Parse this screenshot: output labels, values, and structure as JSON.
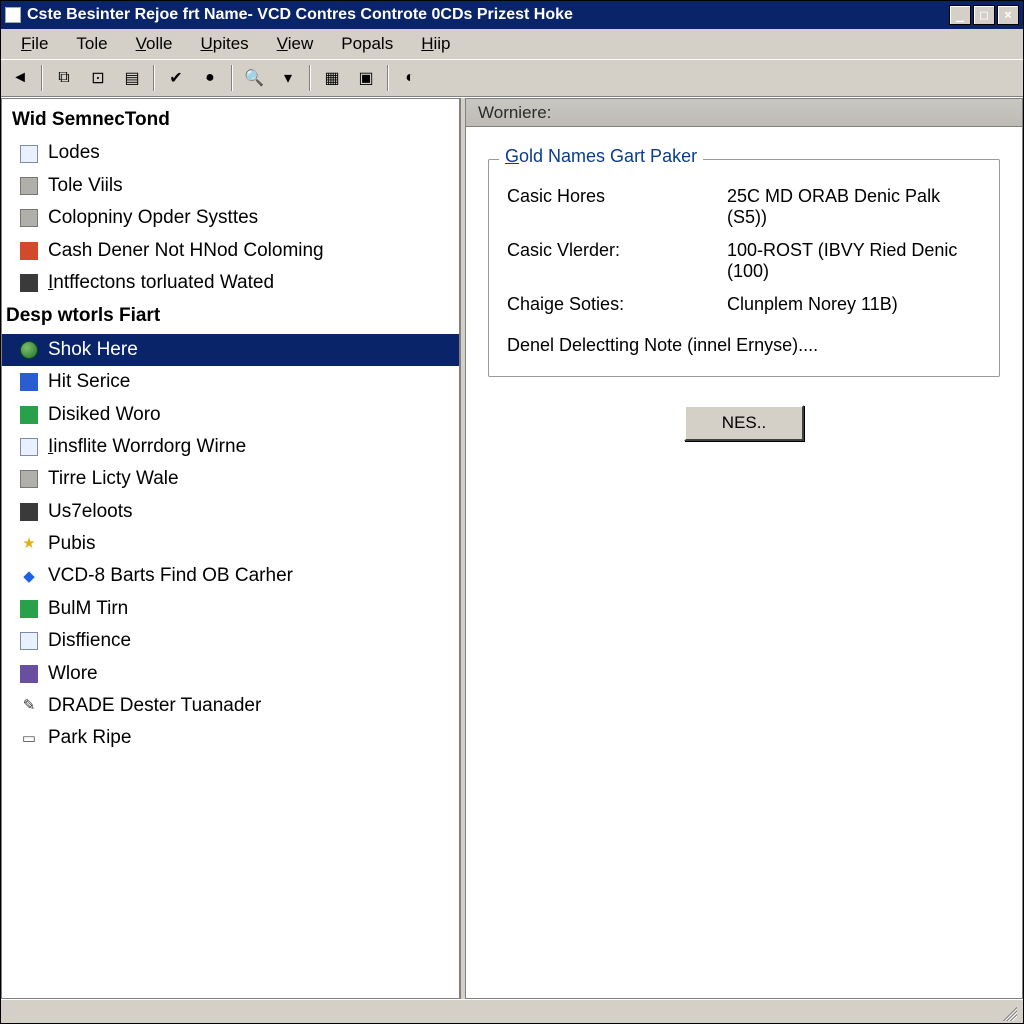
{
  "titlebar": {
    "title": "Cste Besinter Rejoe frt Name- VCD Contres Controte 0CDs Prizest Hoke",
    "buttons": {
      "minimize": "_",
      "maximize": "□",
      "close": "×"
    }
  },
  "menubar": [
    {
      "label": "File",
      "accel": "F"
    },
    {
      "label": "Tole",
      "accel": ""
    },
    {
      "label": "Volle",
      "accel": "V"
    },
    {
      "label": "Upites",
      "accel": "U"
    },
    {
      "label": "View",
      "accel": "V"
    },
    {
      "label": "Popals",
      "accel": ""
    },
    {
      "label": "Hiip",
      "accel": "H"
    }
  ],
  "toolbar": {
    "icons": [
      "back-icon",
      "copy-icon",
      "record-icon",
      "form-icon",
      "tag-icon",
      "tag2-icon",
      "zoom-icon",
      "down-icon",
      "table-icon",
      "chart-icon",
      "shield-icon"
    ]
  },
  "left": {
    "groups": [
      {
        "title": "Wid SemnecTond",
        "items": [
          {
            "icon": "doc-icon",
            "cls": "ic-doc",
            "label": "Lodes",
            "u": 0
          },
          {
            "icon": "vials-icon",
            "cls": "ic-gray",
            "label": "Tole Viils",
            "u": 0
          },
          {
            "icon": "list-icon",
            "cls": "ic-gray",
            "label": "Colopniny Opder Systtes",
            "u": 0
          },
          {
            "icon": "cash-icon",
            "cls": "ic-red",
            "label": "Cash Dener Not HNod Coloming",
            "u": 0
          },
          {
            "icon": "infect-icon",
            "cls": "ic-dark",
            "label": "Intffectons torluated Wated",
            "u": 1
          }
        ]
      },
      {
        "title": "Desp wtorls Fiart",
        "items": [
          {
            "icon": "globe-icon",
            "cls": "ic-globe",
            "label": "Shok Here",
            "selected": true,
            "u": 0
          },
          {
            "icon": "service-icon",
            "cls": "ic-blue",
            "label": "Hit Serice",
            "u": 0
          },
          {
            "icon": "disk-icon",
            "cls": "ic-green",
            "label": "Disiked Woro",
            "u": 0
          },
          {
            "icon": "doc2-icon",
            "cls": "ic-doc",
            "label": "Iinsflite Worrdorg Wirne",
            "u": 1
          },
          {
            "icon": "time-icon",
            "cls": "ic-gray",
            "label": "Tirre Licty Wale",
            "u": 0
          },
          {
            "icon": "nodes-icon",
            "cls": "ic-dark",
            "label": "Us7eloots",
            "u": 0
          },
          {
            "icon": "star-icon",
            "cls": "ic-star",
            "label": "Pubis",
            "u": 0
          },
          {
            "icon": "diamond-icon",
            "cls": "ic-diamond",
            "label": "VCD-8 Barts Find OB Carher",
            "u": 0
          },
          {
            "icon": "bulm-icon",
            "cls": "ic-green",
            "label": "BulM Tirn",
            "u": 0
          },
          {
            "icon": "disf-icon",
            "cls": "ic-doc",
            "label": "Disffience",
            "u": 0
          },
          {
            "icon": "wlore-icon",
            "cls": "ic-violet",
            "label": "Wlore",
            "u": 0
          },
          {
            "icon": "pencil-icon",
            "cls": "ic-pencil",
            "label": "DRADE Dester Tuanader",
            "u": 0
          },
          {
            "icon": "box-icon",
            "cls": "ic-box",
            "label": "Park Ripe",
            "u": 0
          }
        ]
      }
    ]
  },
  "right": {
    "header": "Worniere:",
    "groupbox": {
      "legend": "Gold Names Gart Paker",
      "fields": [
        {
          "label": "Casic Hores",
          "value": "25C MD ORAB Denic Palk (S5))"
        },
        {
          "label": "Casic Vlerder:",
          "value": "100-ROST (IBVY Ried Denic (100)"
        },
        {
          "label": "Chaige Soties:",
          "value": "Clunplem Norey 11B)"
        }
      ],
      "note": "Denel Delectting Note (innel Ernyse)...."
    },
    "button_label": "NES.."
  }
}
